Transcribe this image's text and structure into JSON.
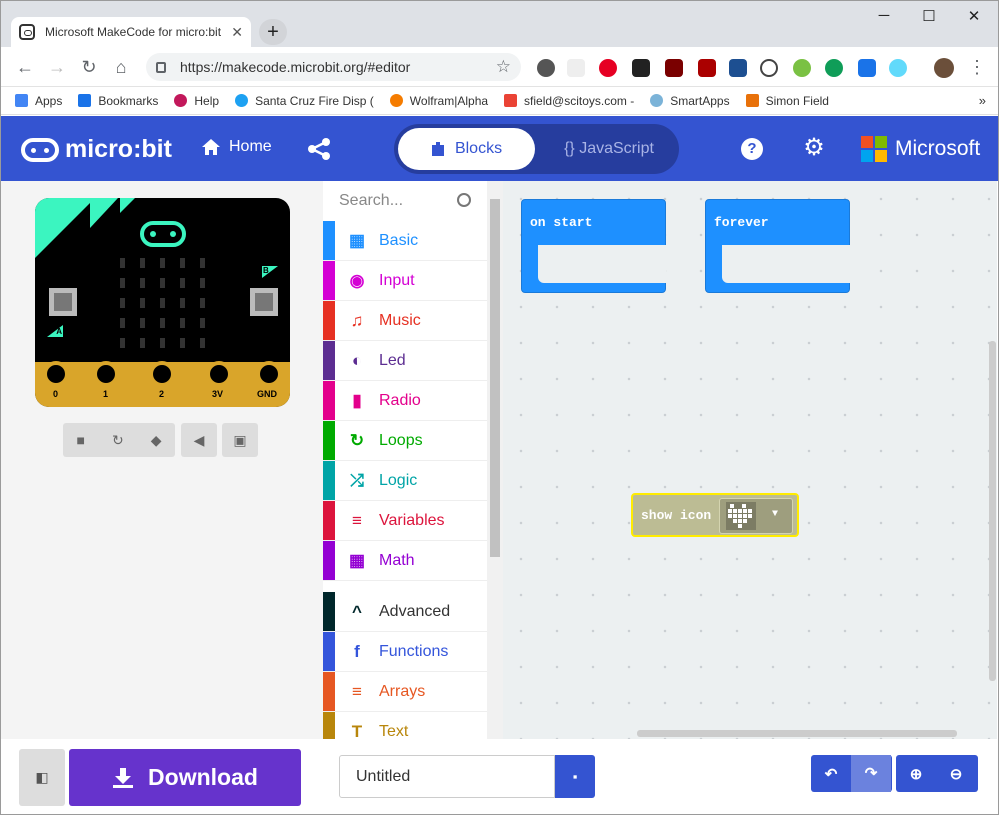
{
  "browser": {
    "tab_title": "Microsoft MakeCode for micro:bit",
    "tab_close": "✕",
    "new_tab": "+",
    "url": "https://makecode.microbit.org/#editor",
    "window_controls": [
      "─",
      "☐",
      "✕"
    ],
    "bookmarks": [
      {
        "label": "Apps",
        "color": "#4285f4"
      },
      {
        "label": "Bookmarks",
        "color": "#1a73e8"
      },
      {
        "label": "Help",
        "color": "#c2185b"
      },
      {
        "label": "Santa Cruz Fire Disp (",
        "color": "#1da1f2"
      },
      {
        "label": "Wolfram|Alpha",
        "color": "#f57c00"
      },
      {
        "label": "sfield@scitoys.com -",
        "color": "#ea4335"
      },
      {
        "label": "SmartApps",
        "color": "#7bb3d8"
      },
      {
        "label": "Simon Field",
        "color": "#e8710a"
      }
    ],
    "bookmarks_more": "»"
  },
  "header": {
    "logo": "micro:bit",
    "home": "Home",
    "blocks": "Blocks",
    "javascript": "{} JavaScript",
    "help": "?",
    "brand": "Microsoft"
  },
  "simulator": {
    "pins": [
      "0",
      "1",
      "2",
      "3V",
      "GND"
    ],
    "button_a": "A",
    "button_b": "B"
  },
  "toolbox": {
    "search_placeholder": "Search...",
    "categories": [
      {
        "label": "Basic",
        "color": "#1e90ff",
        "icon": "▦"
      },
      {
        "label": "Input",
        "color": "#d400d4",
        "icon": "◉"
      },
      {
        "label": "Music",
        "color": "#e63022",
        "icon": "♫"
      },
      {
        "label": "Led",
        "color": "#5c2d91",
        "icon": "◐"
      },
      {
        "label": "Radio",
        "color": "#e3008c",
        "icon": "▮"
      },
      {
        "label": "Loops",
        "color": "#00aa00",
        "icon": "↻"
      },
      {
        "label": "Logic",
        "color": "#00a4a6",
        "icon": "⤮"
      },
      {
        "label": "Variables",
        "color": "#dc143c",
        "icon": "≡"
      },
      {
        "label": "Math",
        "color": "#9400d3",
        "icon": "▦"
      }
    ],
    "advanced": [
      {
        "label": "Advanced",
        "color": "#00272b",
        "icon": "^",
        "text_color": "#333"
      },
      {
        "label": "Functions",
        "color": "#3455db",
        "icon": "f",
        "text_color": "#3455db"
      },
      {
        "label": "Arrays",
        "color": "#e65722",
        "icon": "≡",
        "text_color": "#e65722"
      },
      {
        "label": "Text",
        "color": "#b8860b",
        "icon": "T",
        "text_color": "#b8860b"
      }
    ]
  },
  "workspace": {
    "on_start": "on start",
    "forever": "forever",
    "show_icon": "show icon"
  },
  "bottom": {
    "download": "Download",
    "project_name": "Untitled"
  }
}
